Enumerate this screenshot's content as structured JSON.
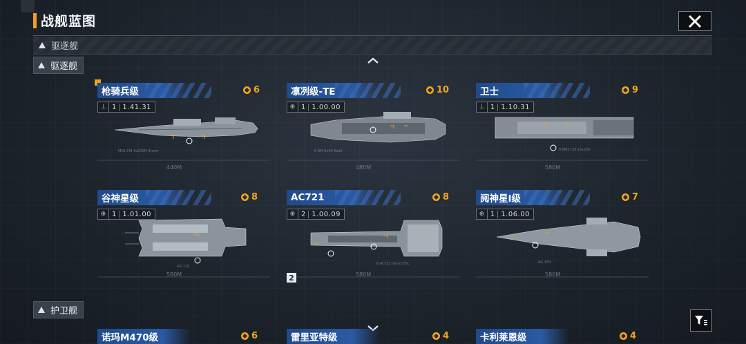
{
  "header": {
    "title": "战舰蓝图",
    "close_icon": "close-icon"
  },
  "category_bar": {
    "label": "驱逐舰"
  },
  "sections": {
    "destroyer": "驱逐舰",
    "frigate": "护卫舰"
  },
  "colors": {
    "accent": "#f0a020",
    "name_bar": "#2a5aa3"
  },
  "cards": [
    {
      "name": "枪骑兵级",
      "cost": "6",
      "version": "1",
      "stats": "1.41.31",
      "stat_icon": "ship-icon",
      "scale": "440M"
    },
    {
      "name": "凛冽级-TE",
      "cost": "10",
      "version": "1",
      "stats": "1.00.00",
      "stat_icon": "globe-icon",
      "scale": "480M"
    },
    {
      "name": "卫士",
      "cost": "9",
      "version": "1",
      "stats": "1.10.31",
      "stat_icon": "ship-icon",
      "scale": "580M"
    },
    {
      "name": "谷神星级",
      "cost": "8",
      "version": "1",
      "stats": "1.01.00",
      "stat_icon": "globe-icon",
      "scale": "580M"
    },
    {
      "name": "AC721",
      "cost": "8",
      "version": "2",
      "stats": "1.00.09",
      "stat_icon": "globe-icon",
      "scale": "580M"
    },
    {
      "name": "阋神星I级",
      "cost": "7",
      "version": "1",
      "stats": "1.06.00",
      "stat_icon": "globe-icon",
      "scale": "580M"
    }
  ],
  "bottom_cards": [
    {
      "name": "诺玛M470级",
      "cost": "6"
    },
    {
      "name": "雷里亚特级",
      "cost": "4"
    },
    {
      "name": "卡利莱恩级",
      "cost": "4"
    }
  ],
  "badge": "2"
}
